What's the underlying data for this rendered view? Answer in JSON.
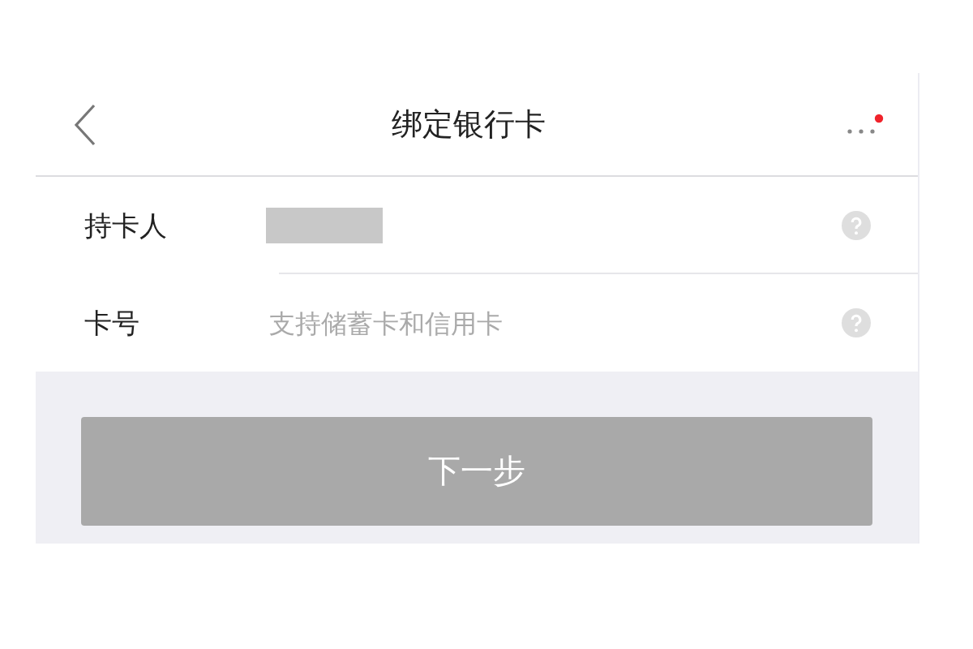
{
  "header": {
    "title": "绑定银行卡",
    "notification_dot": true
  },
  "fields": [
    {
      "label": "持卡人",
      "kind": "redacted"
    },
    {
      "label": "卡号",
      "kind": "input",
      "placeholder": "支持储蓄卡和信用卡"
    }
  ],
  "next_button": {
    "label": "下一步",
    "disabled": true
  }
}
